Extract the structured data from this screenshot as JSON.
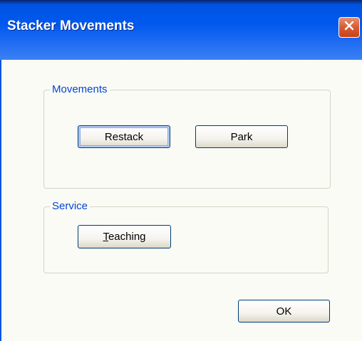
{
  "window": {
    "title": "Stacker Movements"
  },
  "groups": {
    "movements": {
      "label": "Movements",
      "buttons": {
        "restack": "Restack",
        "park": "Park"
      }
    },
    "service": {
      "label": "Service",
      "buttons": {
        "teaching_mnemonic": "T",
        "teaching_rest": "eaching"
      }
    }
  },
  "footer": {
    "ok_label": "OK"
  },
  "icons": {
    "close": "close-icon"
  },
  "colors": {
    "titlebar": "#0058EE",
    "close_button": "#D85A34",
    "groupbox_label": "#0046D5",
    "client_background": "#FBFBF6"
  }
}
